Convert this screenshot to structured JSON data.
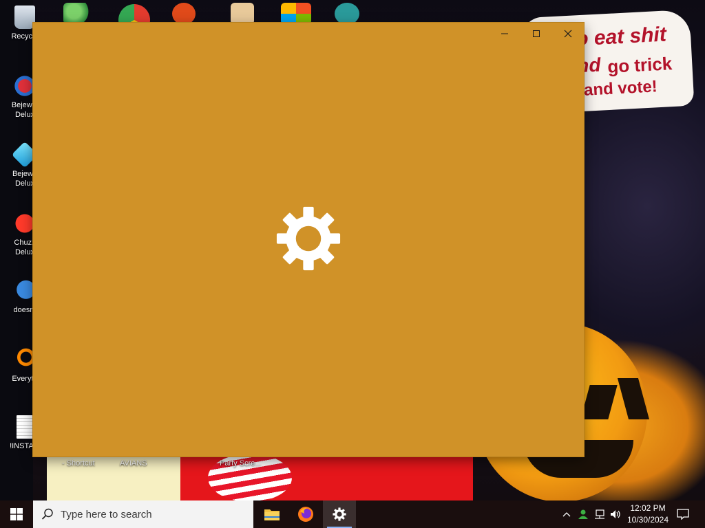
{
  "desktop": {
    "icons_left": [
      {
        "label": "Recycle",
        "name": "recycle-bin-icon"
      },
      {
        "label": "Bejewel Delux",
        "name": "bejeweled2-icon"
      },
      {
        "label": "Bejewe Delux",
        "name": "bejeweled-icon"
      },
      {
        "label": "Chuzz Delux",
        "name": "chuzzle-icon"
      },
      {
        "label": "doesnt",
        "name": "bird-app-icon"
      },
      {
        "label": "Everyth",
        "name": "everything-search-icon"
      },
      {
        "label": "!INSTALI",
        "name": "text-file-icon"
      }
    ],
    "icons_bottom": [
      {
        "label": "- Shortcut"
      },
      {
        "label": "AVIANS"
      },
      {
        "label": "Party Scre..."
      }
    ],
    "speech": {
      "line1": "o eat shit",
      "line2_emph": "nd",
      "line2_rest": "go trick",
      "line3": "and vote!"
    }
  },
  "window": {
    "background": "#d09228",
    "icon": "gear-icon",
    "controls": {
      "minimize": "minimize-icon",
      "maximize": "maximize-icon",
      "close": "close-icon"
    }
  },
  "taskbar": {
    "search_placeholder": "Type here to search",
    "apps": [
      {
        "name": "file-explorer",
        "icon": "folder-icon"
      },
      {
        "name": "firefox",
        "icon": "firefox-icon"
      },
      {
        "name": "settings",
        "icon": "gear-icon",
        "active": true
      }
    ],
    "clock": {
      "time": "12:02 PM",
      "date": "10/30/2024"
    }
  },
  "colors": {
    "accent": "#8ab4f8",
    "window_bg": "#d09228",
    "taskbar": "#1a0e0e"
  }
}
